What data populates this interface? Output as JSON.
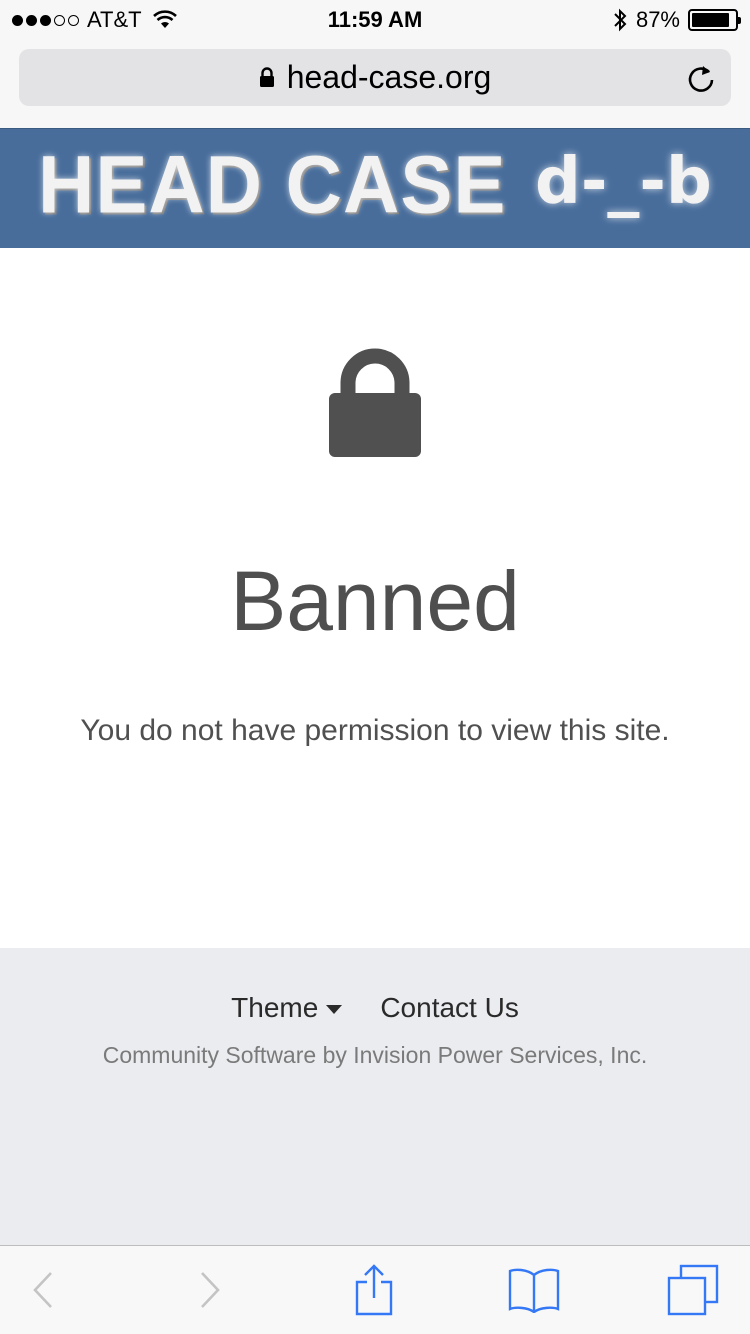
{
  "status_bar": {
    "carrier": "AT&T",
    "time": "11:59 AM",
    "battery_percent": "87%",
    "signal_bars_filled": 3,
    "signal_bars_total": 5
  },
  "browser": {
    "url": "head-case.org",
    "secure": true
  },
  "banner": {
    "logo_text": "HEAD CASE",
    "logo_face": "d-_-b",
    "background_color": "#486d9b"
  },
  "main": {
    "icon": "lock-icon",
    "title": "Banned",
    "message": "You do not have permission to view this site."
  },
  "footer": {
    "theme_label": "Theme",
    "contact_label": "Contact Us",
    "copyright": "Community Software by Invision Power Services, Inc."
  },
  "toolbar": {
    "items": [
      "back-icon",
      "forward-icon",
      "share-icon",
      "bookmarks-icon",
      "tabs-icon"
    ],
    "accent_color": "#3478f6"
  }
}
